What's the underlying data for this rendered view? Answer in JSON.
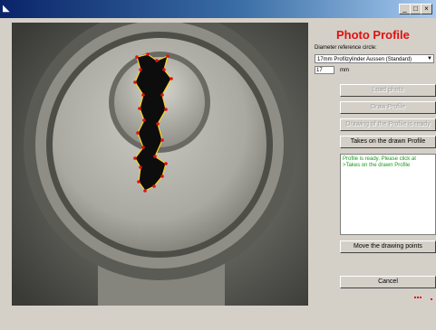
{
  "window": {
    "minimize_glyph": "_",
    "maximize_glyph": "□",
    "close_glyph": "×",
    "icon": "app-icon"
  },
  "panel": {
    "title": "Photo Profile",
    "diameter_label": "Diameter reference circle:",
    "diameter_option": "17mm Profilzylinder Aussen (Standard)",
    "diameter_value": "17",
    "unit": "mm"
  },
  "buttons": {
    "load_photo": "Load photo",
    "draw_profile": "Draw Profile",
    "drawing_ready": "Drawing of the Profile is ready",
    "takes_on": "Takes on the drawn Profile",
    "move_points": "Move the drawing points",
    "cancel": "Cancel"
  },
  "message": "Profile is ready. Please click at\n>Takes on the drawn Profile",
  "colors": {
    "title": "#e01010",
    "profile_line": "#ffd21e",
    "profile_points": "#e01010",
    "message_text": "#1a9a1a"
  }
}
